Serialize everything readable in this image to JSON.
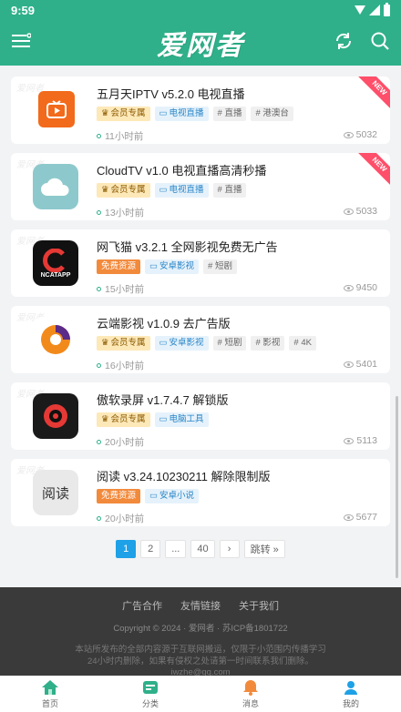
{
  "status": {
    "time": "9:59"
  },
  "header": {
    "logo": "爱网者"
  },
  "watermark": "爱网者",
  "items": [
    {
      "title": "五月天IPTV v5.2.0 电视直播",
      "tags": [
        {
          "type": "vip",
          "label": "会员专属"
        },
        {
          "type": "cat",
          "label": "电视直播"
        },
        {
          "type": "hash",
          "label": "# 直播"
        },
        {
          "type": "hash",
          "label": "# 港澳台"
        }
      ],
      "time": "11小时前",
      "views": "5032",
      "ribbon": "NEW"
    },
    {
      "title": "CloudTV v1.0 电视直播高清秒播",
      "tags": [
        {
          "type": "vip",
          "label": "会员专属"
        },
        {
          "type": "cat",
          "label": "电视直播"
        },
        {
          "type": "hash",
          "label": "# 直播"
        }
      ],
      "time": "13小时前",
      "views": "5033",
      "ribbon": "NEW"
    },
    {
      "title": "网飞猫 v3.2.1 全网影视免费无广告",
      "tags": [
        {
          "type": "free",
          "label": "免费资源"
        },
        {
          "type": "cat",
          "label": "安卓影视"
        },
        {
          "type": "hash",
          "label": "# 短剧"
        }
      ],
      "time": "15小时前",
      "views": "9450",
      "ribbon": ""
    },
    {
      "title": "云端影视 v1.0.9 去广告版",
      "tags": [
        {
          "type": "vip",
          "label": "会员专属"
        },
        {
          "type": "cat",
          "label": "安卓影视"
        },
        {
          "type": "hash",
          "label": "# 短剧"
        },
        {
          "type": "hash",
          "label": "# 影视"
        },
        {
          "type": "hash",
          "label": "# 4K"
        }
      ],
      "time": "16小时前",
      "views": "5401",
      "ribbon": ""
    },
    {
      "title": "傲软录屏 v1.7.4.7 解锁版",
      "tags": [
        {
          "type": "vip",
          "label": "会员专属"
        },
        {
          "type": "cat",
          "label": "电脑工具"
        }
      ],
      "time": "20小时前",
      "views": "5113",
      "ribbon": ""
    },
    {
      "title": "阅读 v3.24.10230211 解除限制版",
      "tags": [
        {
          "type": "free",
          "label": "免费资源"
        },
        {
          "type": "cat",
          "label": "安卓小说"
        }
      ],
      "time": "20小时前",
      "views": "5677",
      "ribbon": ""
    }
  ],
  "thumb_labels": {
    "ncat": "NCATAPP",
    "read": "阅读"
  },
  "pager": {
    "pages": [
      "1",
      "2",
      "...",
      "40"
    ],
    "next": "›",
    "jump": "跳转 »"
  },
  "footer": {
    "links": [
      "广告合作",
      "友情链接",
      "关于我们"
    ],
    "copyright": "Copyright © 2024 · 爱网者 · 苏ICP备1801722",
    "note1": "本站所发布的全部内容源于互联网搬运，仅限于小范围内传播学习",
    "note2": "24小时内删除，如果有侵权之处请第一时间联系我们删除。",
    "email": "iwzhe@qq.com"
  },
  "tabbar": [
    {
      "label": "首页",
      "icon": "home-icon",
      "color": "#2fb08a"
    },
    {
      "label": "分类",
      "icon": "category-icon",
      "color": "#2fb08a"
    },
    {
      "label": "消息",
      "icon": "bell-icon",
      "color": "#f28a3c"
    },
    {
      "label": "我的",
      "icon": "user-icon",
      "color": "#1ea1e6"
    }
  ],
  "colors": {
    "primary": "#2fb08a",
    "accent": "#1ea1e6",
    "ribbon": "#ff4f6a"
  }
}
